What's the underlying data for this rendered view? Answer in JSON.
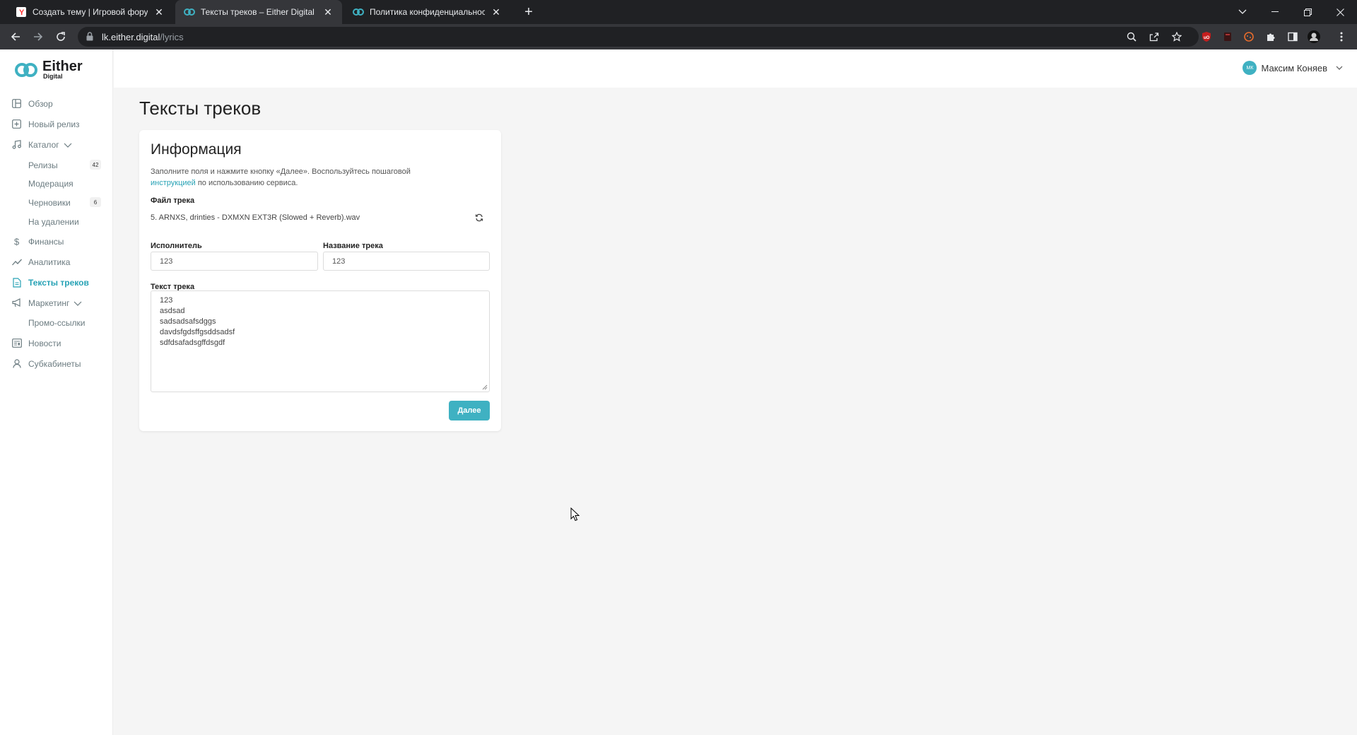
{
  "browser": {
    "tabs": [
      {
        "title": "Создать тему | Игровой форум",
        "favicon": "yandex-icon"
      },
      {
        "title": "Тексты треков – Either Digital",
        "favicon": "either-logo-icon",
        "active": true
      },
      {
        "title": "Политика конфиденциальности",
        "favicon": "either-logo-icon"
      }
    ],
    "url_host": "lk.either.digital",
    "url_path": "/lyrics"
  },
  "sidebar": {
    "logo_word": "Either",
    "logo_sub": "Digital",
    "items": [
      {
        "label": "Обзор",
        "icon": "dashboard-icon"
      },
      {
        "label": "Новый релиз",
        "icon": "plus-square-icon"
      },
      {
        "label": "Каталог",
        "icon": "music-note-icon"
      },
      {
        "label": "Релизы",
        "badge": "42"
      },
      {
        "label": "Модерация"
      },
      {
        "label": "Черновики",
        "badge": "6"
      },
      {
        "label": "На удалении"
      },
      {
        "label": "Финансы",
        "icon": "dollar-icon"
      },
      {
        "label": "Аналитика",
        "icon": "chart-line-icon"
      },
      {
        "label": "Тексты треков",
        "icon": "document-icon",
        "active": true
      },
      {
        "label": "Маркетинг",
        "icon": "megaphone-icon"
      },
      {
        "label": "Промо-ссылки"
      },
      {
        "label": "Новости",
        "icon": "newspaper-icon"
      },
      {
        "label": "Субкабинеты",
        "icon": "user-icon"
      }
    ]
  },
  "header": {
    "user_initials": "МК",
    "user_name": "Максим Коняев"
  },
  "main": {
    "page_title": "Тексты треков",
    "card": {
      "title": "Информация",
      "desc_before": "Заполните поля и нажмите кнопку «Далее». Воспользуйтесь пошаговой",
      "desc_link": "инструкцией",
      "desc_after": " по использованию сервиса.",
      "file_label": "Файл трека",
      "file_name": "5. ARNXS, drinties - DXMXN EXT3R (Slowed + Reverb).wav",
      "artist_label": "Исполнитель",
      "artist_value": "123",
      "track_label": "Название трека",
      "track_value": "123",
      "lyrics_label": "Текст трека",
      "lyrics_lines": [
        "123",
        "asdsad",
        "sadsadsafsdggs",
        "davdsfgdsffgsddsadsf",
        "sdfdsafadsgffdsgdf"
      ],
      "next_button": "Далее"
    }
  },
  "colors": {
    "accent": "#3fb1c2",
    "active_nav": "#27a2b5",
    "chrome_dark": "#202124",
    "chrome_toolbar": "#35363a"
  }
}
